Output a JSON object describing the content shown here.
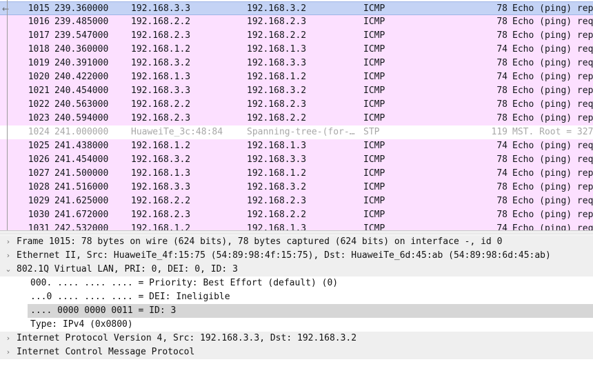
{
  "packets": [
    {
      "no": "1015",
      "time": "239.360000",
      "src": "192.168.3.3",
      "dst": "192.168.3.2",
      "proto": "ICMP",
      "len": "78",
      "info": "Echo (ping) rep",
      "kind": "icmp",
      "selected": true
    },
    {
      "no": "1016",
      "time": "239.485000",
      "src": "192.168.2.2",
      "dst": "192.168.2.3",
      "proto": "ICMP",
      "len": "78",
      "info": "Echo (ping) req",
      "kind": "icmp"
    },
    {
      "no": "1017",
      "time": "239.547000",
      "src": "192.168.2.3",
      "dst": "192.168.2.2",
      "proto": "ICMP",
      "len": "78",
      "info": "Echo (ping) rep",
      "kind": "icmp"
    },
    {
      "no": "1018",
      "time": "240.360000",
      "src": "192.168.1.2",
      "dst": "192.168.1.3",
      "proto": "ICMP",
      "len": "74",
      "info": "Echo (ping) req",
      "kind": "icmp"
    },
    {
      "no": "1019",
      "time": "240.391000",
      "src": "192.168.3.2",
      "dst": "192.168.3.3",
      "proto": "ICMP",
      "len": "78",
      "info": "Echo (ping) req",
      "kind": "icmp"
    },
    {
      "no": "1020",
      "time": "240.422000",
      "src": "192.168.1.3",
      "dst": "192.168.1.2",
      "proto": "ICMP",
      "len": "74",
      "info": "Echo (ping) rep",
      "kind": "icmp"
    },
    {
      "no": "1021",
      "time": "240.454000",
      "src": "192.168.3.3",
      "dst": "192.168.3.2",
      "proto": "ICMP",
      "len": "78",
      "info": "Echo (ping) rep",
      "kind": "icmp"
    },
    {
      "no": "1022",
      "time": "240.563000",
      "src": "192.168.2.2",
      "dst": "192.168.2.3",
      "proto": "ICMP",
      "len": "78",
      "info": "Echo (ping) req",
      "kind": "icmp"
    },
    {
      "no": "1023",
      "time": "240.594000",
      "src": "192.168.2.3",
      "dst": "192.168.2.2",
      "proto": "ICMP",
      "len": "78",
      "info": "Echo (ping) rep",
      "kind": "icmp"
    },
    {
      "no": "1024",
      "time": "241.000000",
      "src": "HuaweiTe_3c:48:84",
      "dst": "Spanning-tree-(for-…",
      "proto": "STP",
      "len": "119",
      "info": "MST. Root = 327",
      "kind": "stp"
    },
    {
      "no": "1025",
      "time": "241.438000",
      "src": "192.168.1.2",
      "dst": "192.168.1.3",
      "proto": "ICMP",
      "len": "74",
      "info": "Echo (ping) req",
      "kind": "icmp"
    },
    {
      "no": "1026",
      "time": "241.454000",
      "src": "192.168.3.2",
      "dst": "192.168.3.3",
      "proto": "ICMP",
      "len": "78",
      "info": "Echo (ping) req",
      "kind": "icmp"
    },
    {
      "no": "1027",
      "time": "241.500000",
      "src": "192.168.1.3",
      "dst": "192.168.1.2",
      "proto": "ICMP",
      "len": "74",
      "info": "Echo (ping) rep",
      "kind": "icmp"
    },
    {
      "no": "1028",
      "time": "241.516000",
      "src": "192.168.3.3",
      "dst": "192.168.3.2",
      "proto": "ICMP",
      "len": "78",
      "info": "Echo (ping) rep",
      "kind": "icmp"
    },
    {
      "no": "1029",
      "time": "241.625000",
      "src": "192.168.2.2",
      "dst": "192.168.2.3",
      "proto": "ICMP",
      "len": "78",
      "info": "Echo (ping) req",
      "kind": "icmp"
    },
    {
      "no": "1030",
      "time": "241.672000",
      "src": "192.168.2.3",
      "dst": "192.168.2.2",
      "proto": "ICMP",
      "len": "78",
      "info": "Echo (ping) rep",
      "kind": "icmp"
    },
    {
      "no": "1031",
      "time": "242.532000",
      "src": "192.168.1.2",
      "dst": "192.168.1.3",
      "proto": "ICMP",
      "len": "74",
      "info": "Echo (ping) req",
      "kind": "icmp"
    }
  ],
  "details": {
    "frame": "Frame 1015: 78 bytes on wire (624 bits), 78 bytes captured (624 bits) on interface -, id 0",
    "ethernet": "Ethernet II, Src: HuaweiTe_4f:15:75 (54:89:98:4f:15:75), Dst: HuaweiTe_6d:45:ab (54:89:98:6d:45:ab)",
    "vlan": "802.1Q Virtual LAN, PRI: 0, DEI: 0, ID: 3",
    "vlan_priority": "000. .... .... .... = Priority: Best Effort (default) (0)",
    "vlan_dei": "...0 .... .... .... = DEI: Ineligible",
    "vlan_id": ".... 0000 0000 0011 = ID: 3",
    "vlan_type": "Type: IPv4 (0x0800)",
    "ipv4": "Internet Protocol Version 4, Src: 192.168.3.3, Dst: 192.168.3.2",
    "icmp": "Internet Control Message Protocol"
  },
  "icons": {
    "collapsed": "chevron-right-icon",
    "expanded": "chevron-down-icon",
    "selection": "arrow-left-icon"
  },
  "colors": {
    "icmp_row": "#fce0ff",
    "selected_row": "#c4d3f5",
    "stp_text": "#a8a8a8",
    "detail_highlight": "#d6d6d6"
  }
}
